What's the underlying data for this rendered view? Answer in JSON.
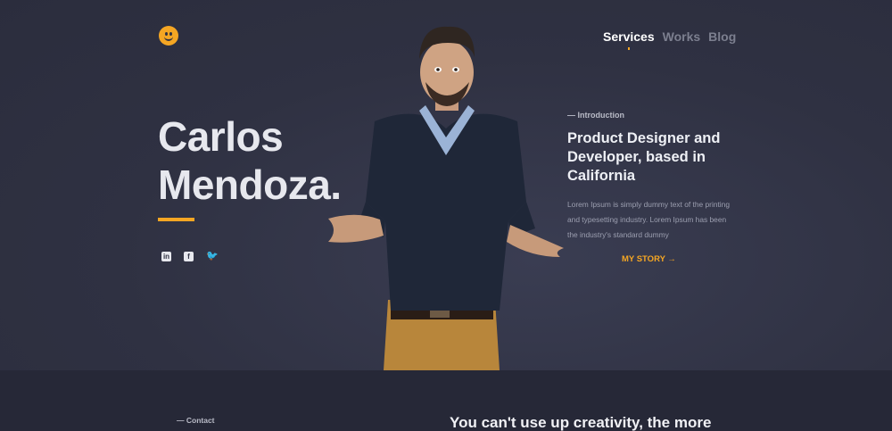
{
  "nav": {
    "items": [
      {
        "label": "Services",
        "active": true
      },
      {
        "label": "Works",
        "active": false
      },
      {
        "label": "Blog",
        "active": false
      }
    ]
  },
  "hero": {
    "name_line1": "Carlos",
    "name_line2": "Mendoza.",
    "socials": [
      {
        "icon": "linkedin-icon",
        "glyph": "in"
      },
      {
        "icon": "facebook-icon",
        "glyph": "f"
      },
      {
        "icon": "twitter-icon",
        "glyph": "🐦"
      }
    ]
  },
  "intro": {
    "label": "— Introduction",
    "title": "Product Designer and Developer, based in California",
    "text": "Lorem Ipsum is simply dummy text of the printing and typesetting industry. Lorem Ipsum has been the industry's standard dummy",
    "story_label": "MY STORY →"
  },
  "contact": {
    "label": "— Contact",
    "quote": "You can't use up creativity, the more"
  },
  "colors": {
    "background": "#2f3142",
    "accent": "#f5a623",
    "footer_band": "#262837"
  }
}
